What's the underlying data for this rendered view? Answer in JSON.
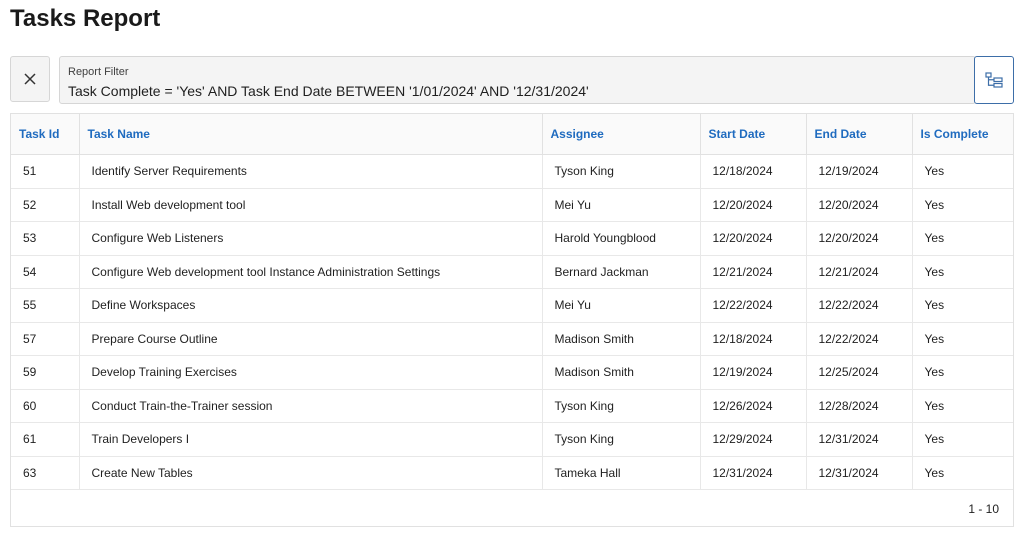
{
  "page": {
    "title": "Tasks Report"
  },
  "filter": {
    "clear_icon": "close-icon",
    "label": "Report Filter",
    "expression": "Task Complete = 'Yes' AND Task End Date BETWEEN '1/01/2024' AND '12/31/2024'",
    "tree_icon": "tree-view-icon",
    "accent_color": "#3d6ea8"
  },
  "table": {
    "header_color": "#1f6bbf",
    "columns": [
      "Task Id",
      "Task Name",
      "Assignee",
      "Start Date",
      "End Date",
      "Is Complete"
    ],
    "rows": [
      [
        "51",
        "Identify Server Requirements",
        "Tyson King",
        "12/18/2024",
        "12/19/2024",
        "Yes"
      ],
      [
        "52",
        "Install Web development tool",
        "Mei Yu",
        "12/20/2024",
        "12/20/2024",
        "Yes"
      ],
      [
        "53",
        "Configure Web Listeners",
        "Harold Youngblood",
        "12/20/2024",
        "12/20/2024",
        "Yes"
      ],
      [
        "54",
        "Configure Web development tool Instance Administration Settings",
        "Bernard Jackman",
        "12/21/2024",
        "12/21/2024",
        "Yes"
      ],
      [
        "55",
        "Define Workspaces",
        "Mei Yu",
        "12/22/2024",
        "12/22/2024",
        "Yes"
      ],
      [
        "57",
        "Prepare Course Outline",
        "Madison Smith",
        "12/18/2024",
        "12/22/2024",
        "Yes"
      ],
      [
        "59",
        "Develop Training Exercises",
        "Madison Smith",
        "12/19/2024",
        "12/25/2024",
        "Yes"
      ],
      [
        "60",
        "Conduct Train-the-Trainer session",
        "Tyson King",
        "12/26/2024",
        "12/28/2024",
        "Yes"
      ],
      [
        "61",
        "Train Developers I",
        "Tyson King",
        "12/29/2024",
        "12/31/2024",
        "Yes"
      ],
      [
        "63",
        "Create New Tables",
        "Tameka Hall",
        "12/31/2024",
        "12/31/2024",
        "Yes"
      ]
    ]
  },
  "pagination": {
    "range": "1 - 10"
  }
}
